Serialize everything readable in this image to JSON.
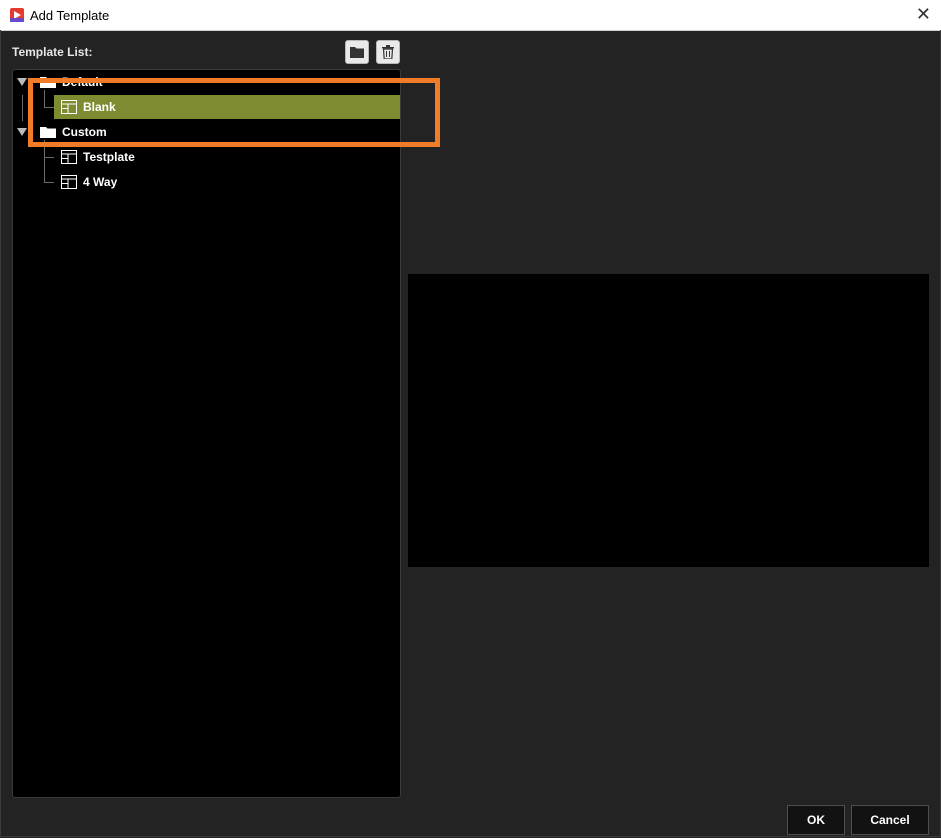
{
  "window": {
    "title": "Add Template",
    "close_glyph": "✕"
  },
  "template_list": {
    "label": "Template List:",
    "tools": [
      {
        "name": "folder-icon"
      },
      {
        "name": "trash-icon"
      }
    ],
    "groups": [
      {
        "label": "Default",
        "items": [
          {
            "label": "Blank",
            "selected": true
          }
        ]
      },
      {
        "label": "Custom",
        "items": [
          {
            "label": "Testplate"
          },
          {
            "label": "4 Way"
          }
        ]
      }
    ]
  },
  "colors": {
    "selection": "#7f8b30",
    "highlight_box": "#f07c27",
    "panel_bg": "#000000",
    "dialog_bg": "#232323"
  },
  "footer": {
    "ok_label": "OK",
    "cancel_label": "Cancel"
  }
}
